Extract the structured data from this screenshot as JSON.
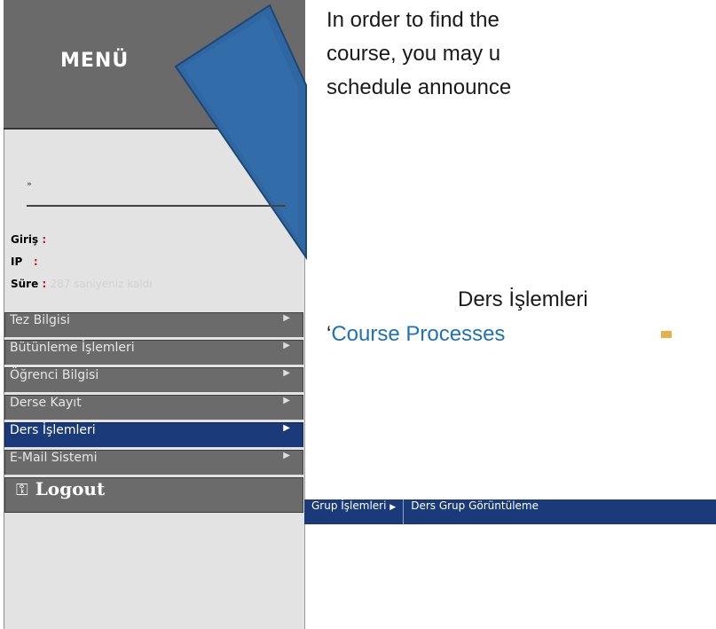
{
  "menu": {
    "title": "MENÜ",
    "breadcrumb": "»",
    "info": {
      "giris_label": "Giriş",
      "ip_label": "IP",
      "sure_label": "Süre",
      "sure_value": "287 saniyeniz kaldı"
    },
    "items": [
      {
        "label": "Tez Bilgisi"
      },
      {
        "label": "Bütünleme İşlemleri"
      },
      {
        "label": "Öğrenci Bilgisi"
      },
      {
        "label": "Derse Kayıt"
      },
      {
        "label": "Ders İşlemleri"
      },
      {
        "label": "E-Mail Sistemi"
      }
    ],
    "logout_label": "Logout"
  },
  "submenu": {
    "group_label": "Grup İşlemleri",
    "view_label": "Ders Grup Görüntüleme"
  },
  "paragraph": {
    "line1": "In order to find the",
    "line2": "course, you may u",
    "line3": "schedule announce"
  },
  "caption": {
    "turkish": "Ders İşlemleri",
    "english": "Course Processes"
  },
  "colors": {
    "menu_bg": "#6b6b6b",
    "active_bg": "#1a3a7a",
    "callout": "#2f67a3",
    "caption_blue": "#1f72b8"
  }
}
